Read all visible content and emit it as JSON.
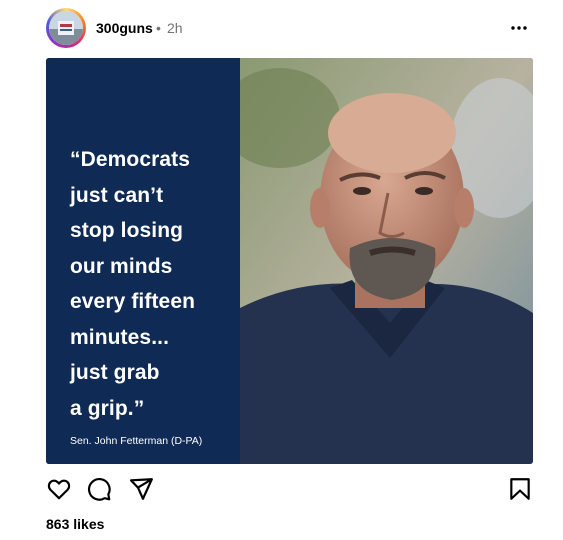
{
  "post": {
    "username": "300guns",
    "separator": "•",
    "time": "2h",
    "quote": "“Democrats\njust can’t\nstop losing\nour minds\nevery fifteen\nminutes...\njust grab\na grip.”",
    "attribution": "Sen. John Fetterman (D-PA)",
    "likes": "863 likes"
  },
  "icons": {
    "more": "more-options-icon",
    "like": "heart-icon",
    "comment": "comment-icon",
    "share": "send-icon",
    "save": "bookmark-icon"
  },
  "colors": {
    "quote_panel": "#0f2a55",
    "text_primary": "#000000",
    "text_secondary": "#737373"
  }
}
